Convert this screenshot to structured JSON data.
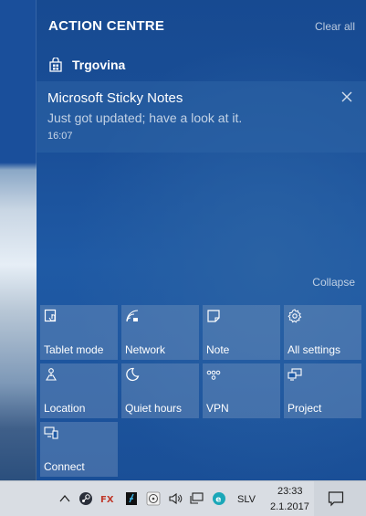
{
  "panel": {
    "title": "ACTION CENTRE",
    "clear_all": "Clear all",
    "collapse": "Collapse"
  },
  "notification_group": {
    "app_name": "Trgovina",
    "app_icon": "store-icon"
  },
  "notification": {
    "title": "Microsoft Sticky Notes",
    "body": "Just got updated; have a look at it.",
    "time": "16:07"
  },
  "quick_actions": [
    {
      "label": "Tablet mode",
      "icon": "tablet-mode-icon"
    },
    {
      "label": "Network",
      "icon": "network-icon"
    },
    {
      "label": "Note",
      "icon": "note-icon"
    },
    {
      "label": "All settings",
      "icon": "settings-gear-icon"
    },
    {
      "label": "Location",
      "icon": "location-icon"
    },
    {
      "label": "Quiet hours",
      "icon": "moon-icon"
    },
    {
      "label": "VPN",
      "icon": "vpn-icon"
    },
    {
      "label": "Project",
      "icon": "project-icon"
    },
    {
      "label": "Connect",
      "icon": "connect-icon"
    }
  ],
  "taskbar": {
    "language": "SLV",
    "time": "23:33",
    "date": "2.1.2017",
    "tray_icons": [
      "chevron-up-icon",
      "steam-icon",
      "fx-icon",
      "app-icon",
      "cd-icon",
      "volume-icon",
      "network-wired-icon",
      "eset-icon"
    ]
  },
  "colors": {
    "panel_bg": "#1a4f98",
    "tile_bg": "#6f92c0",
    "taskbar_bg": "#d9dde3"
  }
}
